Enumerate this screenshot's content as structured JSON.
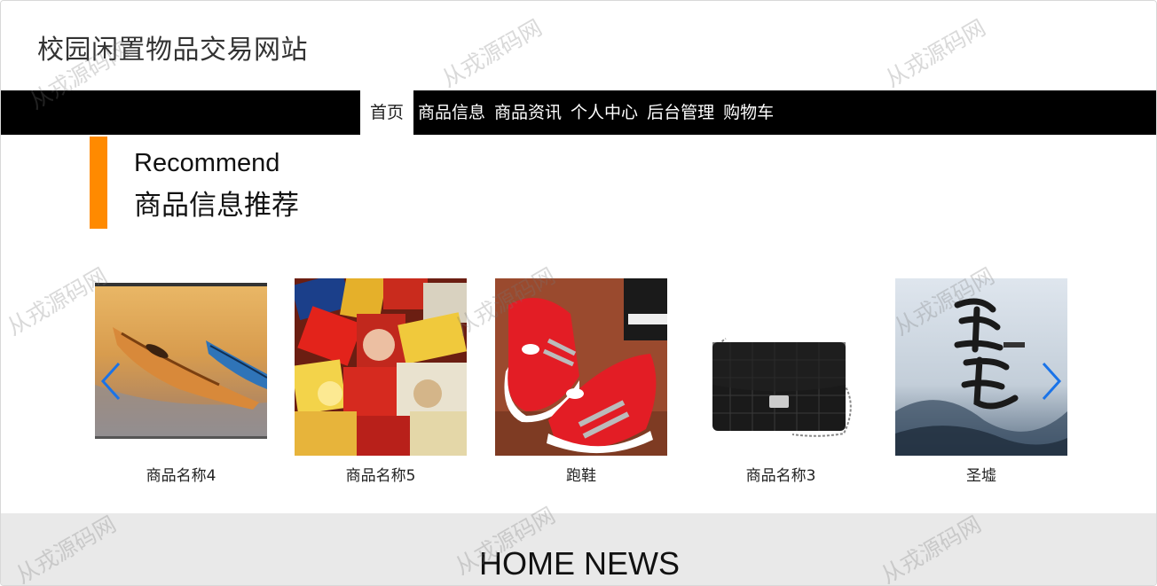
{
  "header": {
    "site_title": "校园闲置物品交易网站"
  },
  "nav": {
    "items": [
      {
        "label": "首页",
        "active": true
      },
      {
        "label": "商品信息",
        "active": false
      },
      {
        "label": "商品资讯",
        "active": false
      },
      {
        "label": "个人中心",
        "active": false
      },
      {
        "label": "后台管理",
        "active": false
      },
      {
        "label": "购物车",
        "active": false
      }
    ]
  },
  "recommend": {
    "title_en": "Recommend",
    "title_cn": "商品信息推荐",
    "accent_color": "#ff8a00"
  },
  "products": [
    {
      "name": "商品名称4",
      "image": "kayak-photo"
    },
    {
      "name": "商品名称5",
      "image": "snacks-photo"
    },
    {
      "name": "跑鞋",
      "image": "red-sneakers-photo"
    },
    {
      "name": "商品名称3",
      "image": "black-handbag-photo"
    },
    {
      "name": "圣墟",
      "image": "book-cover-photo"
    }
  ],
  "carousel": {
    "prev_icon": "chevron-left-icon",
    "next_icon": "chevron-right-icon",
    "arrow_color": "#1a73e8"
  },
  "news": {
    "title": "HOME NEWS"
  },
  "watermark": {
    "text": "从戎源码网"
  }
}
